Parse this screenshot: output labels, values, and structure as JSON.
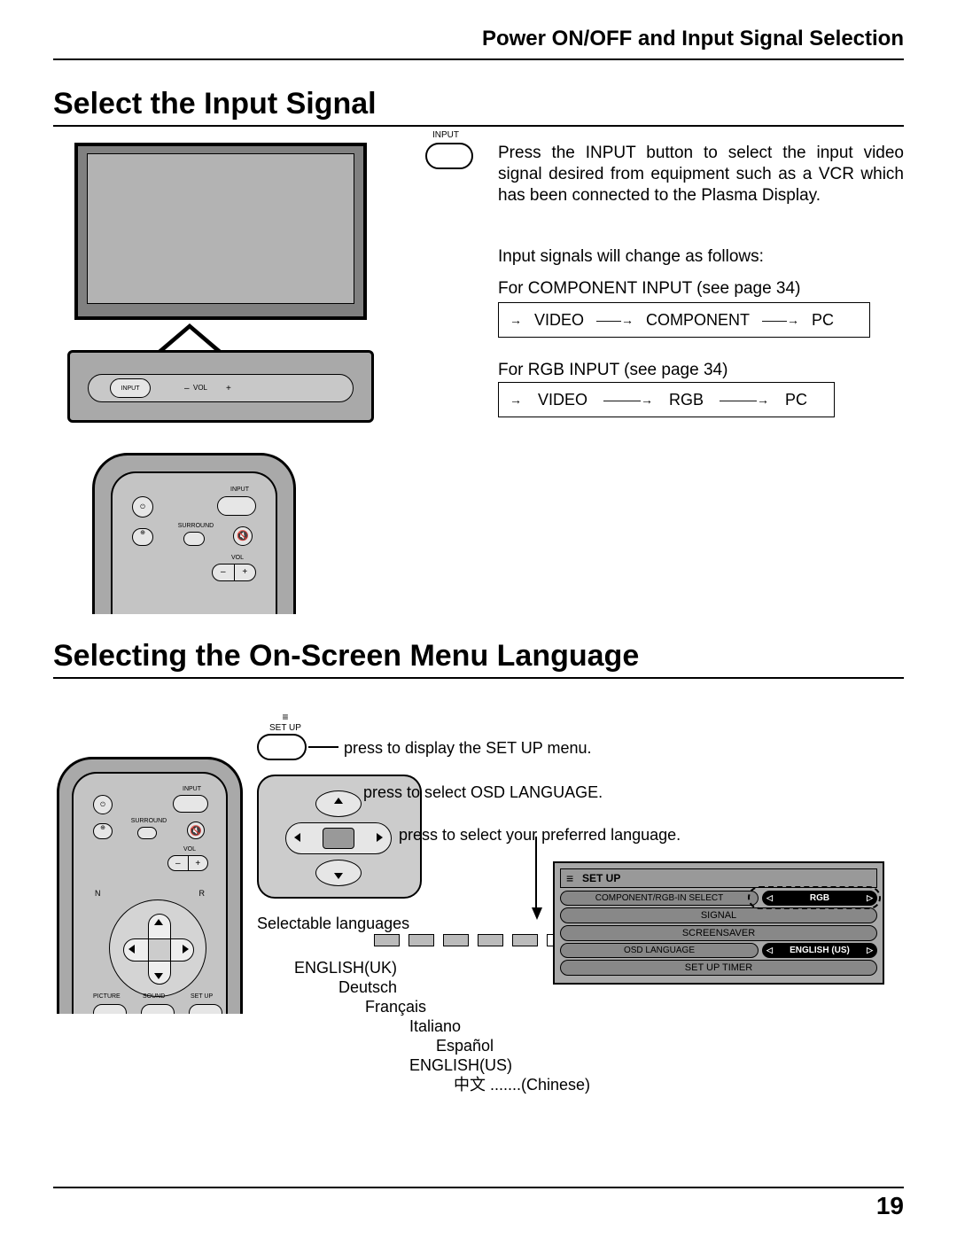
{
  "header": "Power ON/OFF and Input Signal Selection",
  "section1": {
    "title": "Select the Input Signal",
    "input_label": "INPUT",
    "panel_input": "INPUT",
    "panel_vol": "VOL",
    "panel_minus": "–",
    "panel_plus": "+",
    "remote_input": "INPUT",
    "remote_surround": "SURROUND",
    "remote_vol": "VOL",
    "remote_minus": "–",
    "remote_plus": "+",
    "desc": "Press the INPUT button to select the input video signal desired from equipment such as a VCR which has been connected to the Plasma Display.",
    "desc2": "Input signals will change as follows:",
    "desc3": "For COMPONENT INPUT (see page 34)",
    "cycle1": {
      "a": "VIDEO",
      "b": "COMPONENT",
      "c": "PC"
    },
    "desc4": "For RGB INPUT (see page 34)",
    "cycle2": {
      "a": "VIDEO",
      "b": "RGB",
      "c": "PC"
    }
  },
  "section2": {
    "title": "Selecting the On-Screen Menu Language",
    "setup_label": "SET UP",
    "step1": "press to display the SET UP menu.",
    "step2": "press to select OSD LANGUAGE.",
    "step3": "press to select your preferred language.",
    "lang_title": "Selectable languages",
    "langs": {
      "en_uk": "ENGLISH(UK)",
      "de": "Deutsch",
      "fr": "Français",
      "it": "Italiano",
      "es": "Español",
      "en_us": "ENGLISH(US)",
      "cn": "中文 .......(Chinese)"
    },
    "remote": {
      "input": "INPUT",
      "surround": "SURROUND",
      "vol": "VOL",
      "n": "N",
      "r": "R",
      "picture": "PICTURE",
      "sound": "SOUND",
      "setup": "SET UP"
    },
    "osd": {
      "title": "SET  UP",
      "row1_l": "COMPONENT/RGB-IN  SELECT",
      "row1_r": "RGB",
      "row2": "SIGNAL",
      "row3": "SCREENSAVER",
      "row4_l": "OSD  LANGUAGE",
      "row4_r": "ENGLISH (US)",
      "row5": "SET UP TIMER"
    }
  },
  "page_number": "19"
}
